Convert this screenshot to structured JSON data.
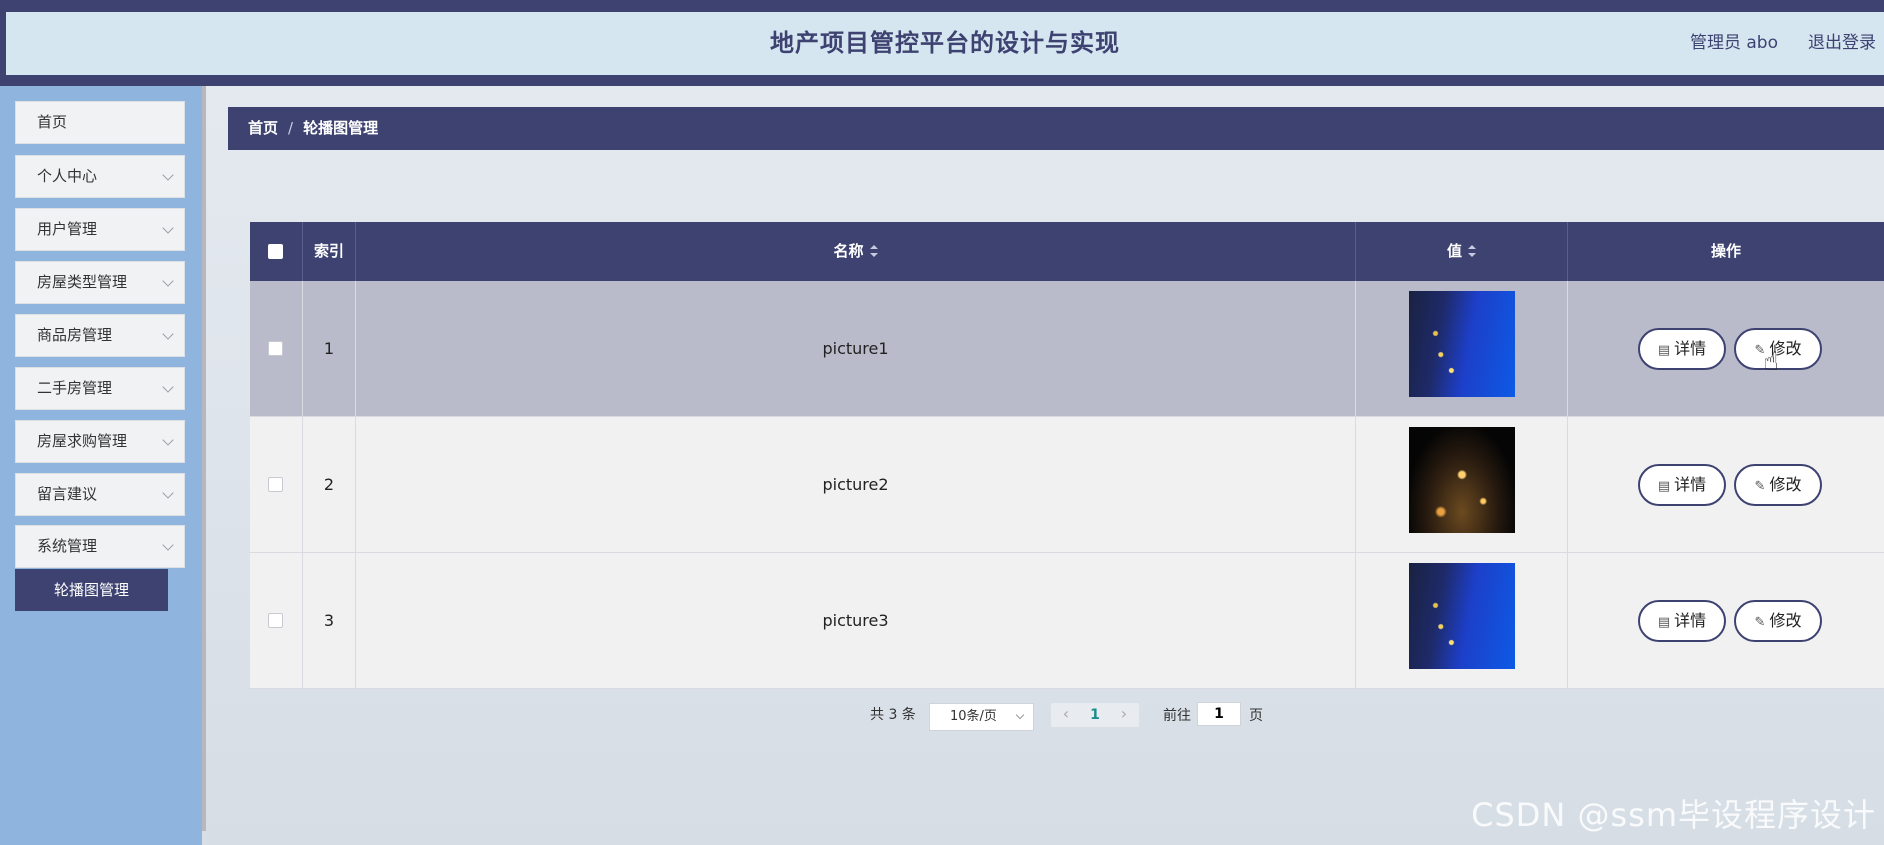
{
  "header": {
    "title": "地产项目管控平台的设计与实现",
    "user": "管理员 abo",
    "logout": "退出登录"
  },
  "sidebar": {
    "items": [
      {
        "label": "首页",
        "has_children": false
      },
      {
        "label": "个人中心",
        "has_children": true
      },
      {
        "label": "用户管理",
        "has_children": true
      },
      {
        "label": "房屋类型管理",
        "has_children": true
      },
      {
        "label": "商品房管理",
        "has_children": true
      },
      {
        "label": "二手房管理",
        "has_children": true
      },
      {
        "label": "房屋求购管理",
        "has_children": true
      },
      {
        "label": "留言建议",
        "has_children": true
      },
      {
        "label": "系统管理",
        "has_children": true
      }
    ],
    "active_subitem": "轮播图管理"
  },
  "breadcrumb": {
    "home": "首页",
    "separator": "/",
    "current": "轮播图管理"
  },
  "table": {
    "columns": {
      "index": "索引",
      "name": "名称",
      "value": "值",
      "actions": "操作"
    },
    "rows": [
      {
        "index": "1",
        "name": "picture1",
        "image": "city-night-blue"
      },
      {
        "index": "2",
        "name": "picture2",
        "image": "city-night-lights"
      },
      {
        "index": "3",
        "name": "picture3",
        "image": "city-night-blue"
      }
    ],
    "detail_label": "详情",
    "edit_label": "修改"
  },
  "pagination": {
    "total": "共 3 条",
    "page_size": "10条/页",
    "current_page": "1",
    "goto_label": "前往",
    "goto_value": "1",
    "goto_suffix": "页"
  },
  "watermark": "CSDN @ssm毕设程序设计",
  "colors": {
    "primary": "#3d4271",
    "header_bg": "#d5e6f1",
    "sidebar_bg": "#8fb4dd",
    "row_hover": "#b9bbcb"
  }
}
